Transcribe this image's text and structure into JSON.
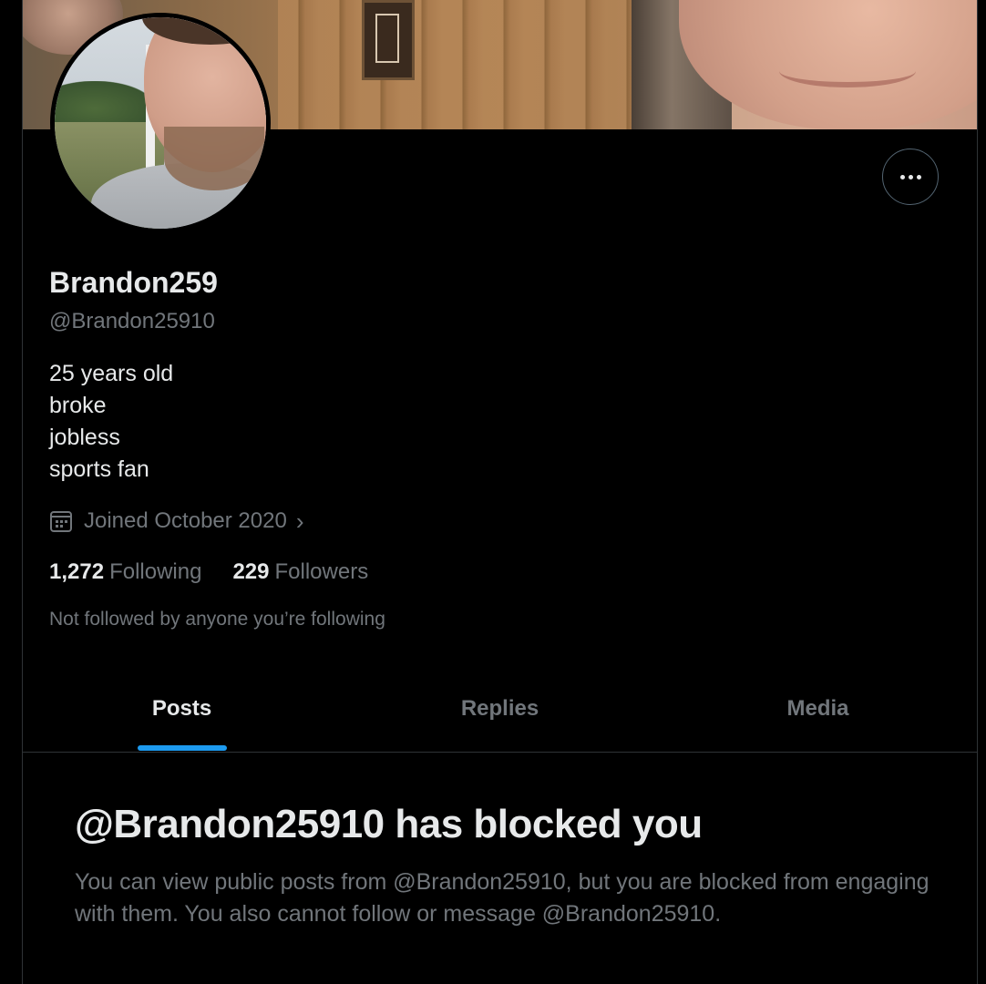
{
  "profile": {
    "display_name": "Brandon259",
    "handle": "@Brandon25910",
    "bio_lines": [
      "25 years old",
      "broke",
      "jobless",
      "sports fan"
    ],
    "joined": "Joined October 2020",
    "following_count": "1,272",
    "following_label": "Following",
    "followers_count": "229",
    "followers_label": "Followers",
    "not_followed_text": "Not followed by anyone you’re following"
  },
  "icons": {
    "more": "more-horizontal-icon",
    "calendar": "calendar-icon",
    "chevron": "chevron-right-icon"
  },
  "tabs": [
    {
      "label": "Posts",
      "active": true
    },
    {
      "label": "Replies",
      "active": false
    },
    {
      "label": "Media",
      "active": false
    }
  ],
  "blocked": {
    "title": "@Brandon25910 has blocked you",
    "text": "You can view public posts from @Brandon25910, but you are blocked from engaging with them. You also cannot follow or message @Brandon25910."
  },
  "colors": {
    "background": "#000000",
    "text_primary": "#e7e9ea",
    "text_secondary": "#71767b",
    "accent": "#1d9bf0",
    "border": "#2f3336"
  }
}
